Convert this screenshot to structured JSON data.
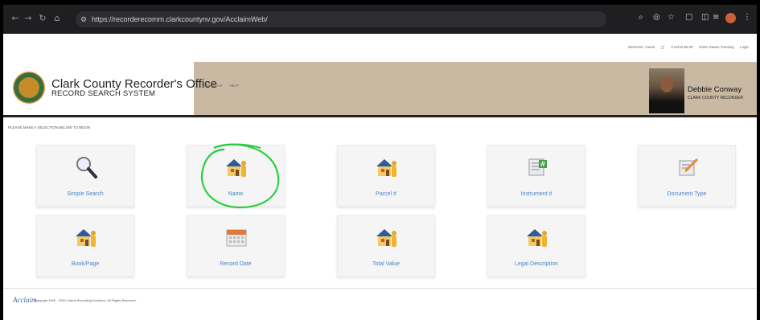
{
  "browser": {
    "url": "https://recorderecomm.clarkcountynv.gov/AcclaimWeb/",
    "icons": [
      "back-icon",
      "forward-icon",
      "reload-icon",
      "home-icon",
      "zoom-icon",
      "eye-off-icon",
      "star-icon",
      "extensions-icon",
      "sidebar-icon",
      "profile-icon",
      "menu-icon"
    ]
  },
  "userbar": {
    "welcome": "Welcome, Guest",
    "cart": "0 Items $0.00",
    "order_status": "Order Status Tracking",
    "login": "Login"
  },
  "header": {
    "title": "Clark County Recorder's Office",
    "subtitle": "RECORD SEARCH SYSTEM",
    "menu_search": "SEARCH ▾",
    "menu_help": "HELP",
    "recorder_name": "Debbie Conway",
    "recorder_title": "CLARK COUNTY RECORDER"
  },
  "prompt": "PLEASE MAKE A SELECTION BELOW TO BEGIN",
  "tiles": [
    {
      "label": "Simple Search",
      "icon": "magnifier-icon"
    },
    {
      "label": "Name",
      "icon": "house-person-icon"
    },
    {
      "label": "Parcel #",
      "icon": "house-person-icon"
    },
    {
      "label": "Instrument #",
      "icon": "document-number-icon"
    },
    {
      "label": "Document Type",
      "icon": "document-pen-icon"
    },
    {
      "label": "Book/Page",
      "icon": "house-person-icon"
    },
    {
      "label": "Record Date",
      "icon": "calendar-icon"
    },
    {
      "label": "Total Value",
      "icon": "house-person-icon"
    },
    {
      "label": "Legal Description",
      "icon": "house-person-icon"
    }
  ],
  "footer": {
    "brand": "Acclaim",
    "copyright": "Copyright 1999 - 2020, Harris Recording Solutions. All Rights Reserved."
  },
  "colors": {
    "link": "#4a84c4",
    "header_band": "#c9b9a3",
    "annotation": "#2ecc40"
  }
}
